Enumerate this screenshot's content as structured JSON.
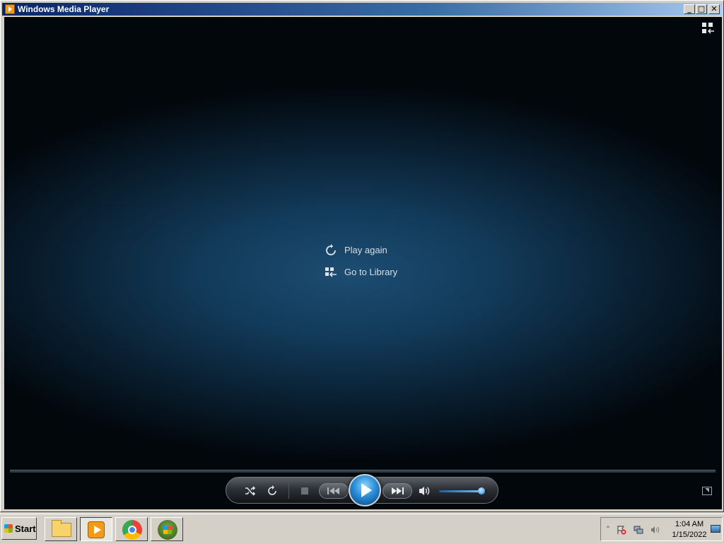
{
  "window": {
    "title": "Windows Media Player",
    "controls": {
      "minimize": "_",
      "maximize": "□",
      "close": "✕"
    }
  },
  "player": {
    "menu": [
      {
        "label": "Play again",
        "icon": "replay-icon"
      },
      {
        "label": "Go to Library",
        "icon": "library-icon"
      }
    ],
    "volume_fraction": 0.88,
    "colors": {
      "accent": "#2a8ed6",
      "background": "#123a59"
    }
  },
  "taskbar": {
    "start_label": "Start",
    "apps": [
      "file-explorer",
      "windows-media-player",
      "google-chrome",
      "windows"
    ],
    "active_app": "windows-media-player",
    "tray": {
      "time": "1:04 AM",
      "date": "1/15/2022",
      "show_hidden": "˄"
    }
  }
}
